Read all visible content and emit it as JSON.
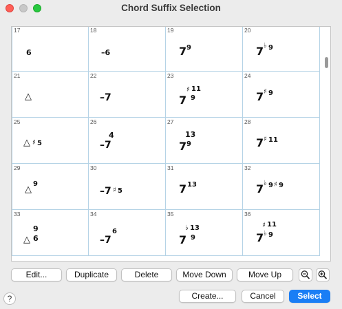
{
  "window": {
    "title": "Chord Suffix Selection"
  },
  "grid": {
    "cells": [
      {
        "num": "17",
        "suffix": "6"
      },
      {
        "num": "18",
        "suffix": "–6"
      },
      {
        "num": "19",
        "suffix": "7 9"
      },
      {
        "num": "20",
        "suffix": "7♭9"
      },
      {
        "num": "21",
        "suffix": "△"
      },
      {
        "num": "22",
        "suffix": "–7"
      },
      {
        "num": "23",
        "suffix": "7 ♯11 9"
      },
      {
        "num": "24",
        "suffix": "7♯9"
      },
      {
        "num": "25",
        "suffix": "△♯5"
      },
      {
        "num": "26",
        "suffix": "–7 4"
      },
      {
        "num": "27",
        "suffix": "7 13 9"
      },
      {
        "num": "28",
        "suffix": "7♯11"
      },
      {
        "num": "29",
        "suffix": "△9"
      },
      {
        "num": "30",
        "suffix": "–7♯5"
      },
      {
        "num": "31",
        "suffix": "7 13"
      },
      {
        "num": "32",
        "suffix": "7♭9♯9"
      },
      {
        "num": "33",
        "suffix": "△ 9 6"
      },
      {
        "num": "34",
        "suffix": "–7 6"
      },
      {
        "num": "35",
        "suffix": "7 ♭13 9"
      },
      {
        "num": "36",
        "suffix": "7 ♯11 ♭9"
      }
    ]
  },
  "toolbar": {
    "edit_label": "Edit...",
    "duplicate_label": "Duplicate",
    "delete_label": "Delete",
    "move_down_label": "Move Down",
    "move_up_label": "Move Up",
    "zoom_out_icon": "zoom-out-icon",
    "zoom_in_icon": "zoom-in-icon"
  },
  "footer": {
    "help_label": "?",
    "create_label": "Create...",
    "cancel_label": "Cancel",
    "select_label": "Select"
  },
  "colors": {
    "accent": "#1a7ef5",
    "grid_line": "#b5d3e6"
  }
}
